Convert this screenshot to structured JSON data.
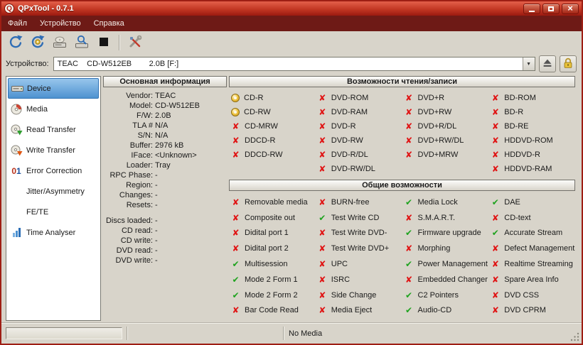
{
  "window": {
    "title": "QPxTool - 0.7.1",
    "logo": "Q",
    "controls": [
      "minimize",
      "maximize",
      "close"
    ]
  },
  "menu": {
    "items": [
      "Файл",
      "Устройство",
      "Справка"
    ]
  },
  "toolbar": {
    "icons": [
      "rescan-bus-icon",
      "refresh-info-icon",
      "load-eject-icon",
      "scan-media-icon",
      "stop-icon",
      "settings-icon"
    ]
  },
  "device_bar": {
    "label": "Устройство:",
    "value": "TEAC    CD-W512EB        2.0B [F:]",
    "buttons": [
      "eject-icon",
      "lock-icon"
    ]
  },
  "sidebar": {
    "items": [
      {
        "label": "Device",
        "icon": "device",
        "selected": true
      },
      {
        "label": "Media",
        "icon": "media",
        "selected": false
      },
      {
        "label": "Read Transfer",
        "icon": "read",
        "selected": false
      },
      {
        "label": "Write Transfer",
        "icon": "write",
        "selected": false
      },
      {
        "label": "Error Correction",
        "icon": "01",
        "icon_text": "01",
        "selected": false
      },
      {
        "label": "Jitter/Asymmetry",
        "icon": "none",
        "selected": false
      },
      {
        "label": "FE/TE",
        "icon": "none",
        "selected": false
      },
      {
        "label": "Time Analyser",
        "icon": "chart",
        "selected": false
      }
    ]
  },
  "info_panel": {
    "title": "Основная информация",
    "rows": [
      {
        "label": "Vendor:",
        "value": "TEAC"
      },
      {
        "label": "Model:",
        "value": "CD-W512EB"
      },
      {
        "label": "F/W:",
        "value": "2.0B"
      },
      {
        "label": "TLA #",
        "value": "N/A"
      },
      {
        "label": "S/N:",
        "value": "N/A"
      },
      {
        "label": "Buffer:",
        "value": "2976 kB"
      },
      {
        "label": "IFace:",
        "value": "<Unknown>"
      },
      {
        "label": "Loader:",
        "value": "Tray"
      },
      {
        "label": "RPC Phase:",
        "value": "-"
      },
      {
        "label": "Region:",
        "value": "-"
      },
      {
        "label": "Changes:",
        "value": "-"
      },
      {
        "label": "Resets:",
        "value": "-"
      },
      {
        "spacer": true
      },
      {
        "label": "Discs loaded:",
        "value": "-"
      },
      {
        "label": "CD read:",
        "value": "-"
      },
      {
        "label": "CD write:",
        "value": "-"
      },
      {
        "label": "DVD read:",
        "value": "-"
      },
      {
        "label": "DVD write:",
        "value": "-"
      }
    ]
  },
  "capabilities": {
    "rw_title": "Возможности чтения/записи",
    "rw_columns": [
      [
        {
          "label": "CD-R",
          "state": "disc"
        },
        {
          "label": "CD-RW",
          "state": "disc"
        },
        {
          "label": "CD-MRW",
          "state": "no"
        },
        {
          "label": "DDCD-R",
          "state": "no"
        },
        {
          "label": "DDCD-RW",
          "state": "no"
        }
      ],
      [
        {
          "label": "DVD-ROM",
          "state": "no"
        },
        {
          "label": "DVD-RAM",
          "state": "no"
        },
        {
          "label": "DVD-R",
          "state": "no"
        },
        {
          "label": "DVD-RW",
          "state": "no"
        },
        {
          "label": "DVD-R/DL",
          "state": "no"
        },
        {
          "label": "DVD-RW/DL",
          "state": "no"
        }
      ],
      [
        {
          "label": "DVD+R",
          "state": "no"
        },
        {
          "label": "DVD+RW",
          "state": "no"
        },
        {
          "label": "DVD+R/DL",
          "state": "no"
        },
        {
          "label": "DVD+RW/DL",
          "state": "no"
        },
        {
          "label": "DVD+MRW",
          "state": "no"
        }
      ],
      [
        {
          "label": "BD-ROM",
          "state": "no"
        },
        {
          "label": "BD-R",
          "state": "no"
        },
        {
          "label": "BD-RE",
          "state": "no"
        },
        {
          "label": "HDDVD-ROM",
          "state": "no"
        },
        {
          "label": "HDDVD-R",
          "state": "no"
        },
        {
          "label": "HDDVD-RAM",
          "state": "no"
        }
      ]
    ],
    "general_title": "Общие возможности",
    "general_columns": [
      [
        {
          "label": "Removable media",
          "state": "no"
        },
        {
          "label": "Composite out",
          "state": "no"
        },
        {
          "label": "Didital port 1",
          "state": "no"
        },
        {
          "label": "Didital port 2",
          "state": "no"
        },
        {
          "label": "Multisession",
          "state": "yes"
        },
        {
          "label": "Mode 2 Form 1",
          "state": "yes"
        },
        {
          "label": "Mode 2 Form 2",
          "state": "yes"
        },
        {
          "label": "Bar Code Read",
          "state": "no"
        }
      ],
      [
        {
          "label": "BURN-free",
          "state": "no"
        },
        {
          "label": "Test Write CD",
          "state": "yes"
        },
        {
          "label": "Test Write DVD-",
          "state": "no"
        },
        {
          "label": "Test Write DVD+",
          "state": "no"
        },
        {
          "label": "UPC",
          "state": "no"
        },
        {
          "label": "ISRC",
          "state": "no"
        },
        {
          "label": "Side Change",
          "state": "no"
        },
        {
          "label": "Media Eject",
          "state": "no"
        }
      ],
      [
        {
          "label": "Media Lock",
          "state": "yes"
        },
        {
          "label": "S.M.A.R.T.",
          "state": "no"
        },
        {
          "label": "Firmware upgrade",
          "state": "yes"
        },
        {
          "label": "Morphing",
          "state": "no"
        },
        {
          "label": "Power Management",
          "state": "yes"
        },
        {
          "label": "Embedded Changer",
          "state": "no"
        },
        {
          "label": "C2 Pointers",
          "state": "yes"
        },
        {
          "label": "Audio-CD",
          "state": "yes"
        }
      ],
      [
        {
          "label": "DAE",
          "state": "yes"
        },
        {
          "label": "CD-text",
          "state": "no"
        },
        {
          "label": "Accurate Stream",
          "state": "yes"
        },
        {
          "label": "Defect Management",
          "state": "no"
        },
        {
          "label": "Realtime Streaming",
          "state": "no"
        },
        {
          "label": "Spare Area Info",
          "state": "no"
        },
        {
          "label": "DVD CSS",
          "state": "no"
        },
        {
          "label": "DVD CPRM",
          "state": "no"
        }
      ]
    ]
  },
  "statusbar": {
    "media_status": "No Media"
  }
}
